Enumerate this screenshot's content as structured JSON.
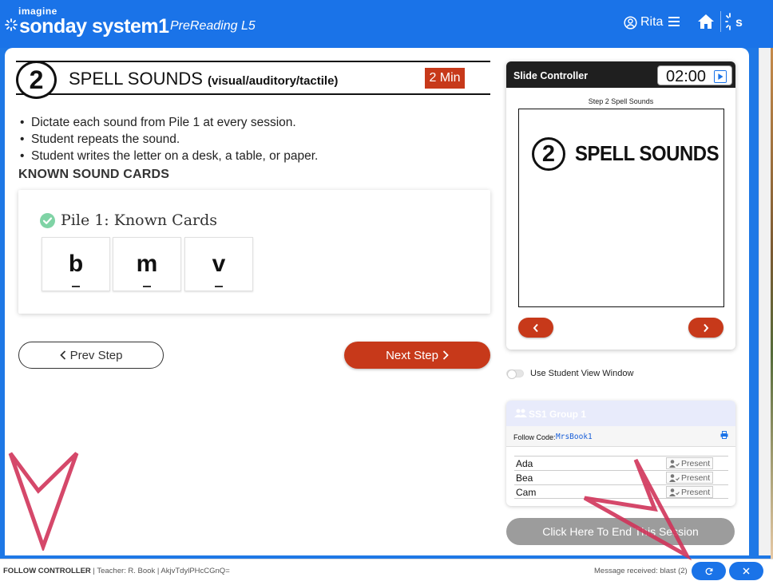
{
  "header": {
    "brand_small": "imagine",
    "brand": "sonday system1",
    "subtitle": "PreReading L5",
    "user_name": "Rita"
  },
  "step": {
    "number": "2",
    "title": "SPELL SOUNDS",
    "subtitle": "(visual/auditory/tactile)",
    "duration": "2 Min",
    "bullets": [
      "Dictate each sound from Pile 1 at every session.",
      "Student repeats the sound.",
      "Student writes the letter on a desk, a table, or paper."
    ],
    "section_heading": "KNOWN SOUND CARDS"
  },
  "pile": {
    "title": "Pile 1: Known Cards",
    "cards": [
      "b",
      "m",
      "v"
    ]
  },
  "nav": {
    "prev_label": "Prev Step",
    "next_label": "Next Step"
  },
  "slide_controller": {
    "title": "Slide Controller",
    "timer": "02:00",
    "caption": "Step 2 Spell Sounds",
    "slide_number": "2",
    "slide_title": "SPELL SOUNDS"
  },
  "student_view": {
    "label": "Use Student View Window",
    "enabled": false
  },
  "group": {
    "name": "SS1 Group 1",
    "follow_label": "Follow Code:",
    "follow_code": "MrsBook1",
    "students": [
      {
        "name": "Ada",
        "status": "Present"
      },
      {
        "name": "Bea",
        "status": "Present"
      },
      {
        "name": "Cam",
        "status": "Present"
      }
    ]
  },
  "end_session": "Click Here To End This Session",
  "footer": {
    "mode": "FOLLOW CONTROLLER",
    "teacher_label": "| Teacher:",
    "teacher_value": "R. Book | AkjvTdylPHcCGnQ=",
    "message": "Message received: blast (2)"
  },
  "colors": {
    "header_blue": "#1a73e8",
    "accent_red": "#c7391a",
    "annotation_pink": "#d0345a"
  }
}
